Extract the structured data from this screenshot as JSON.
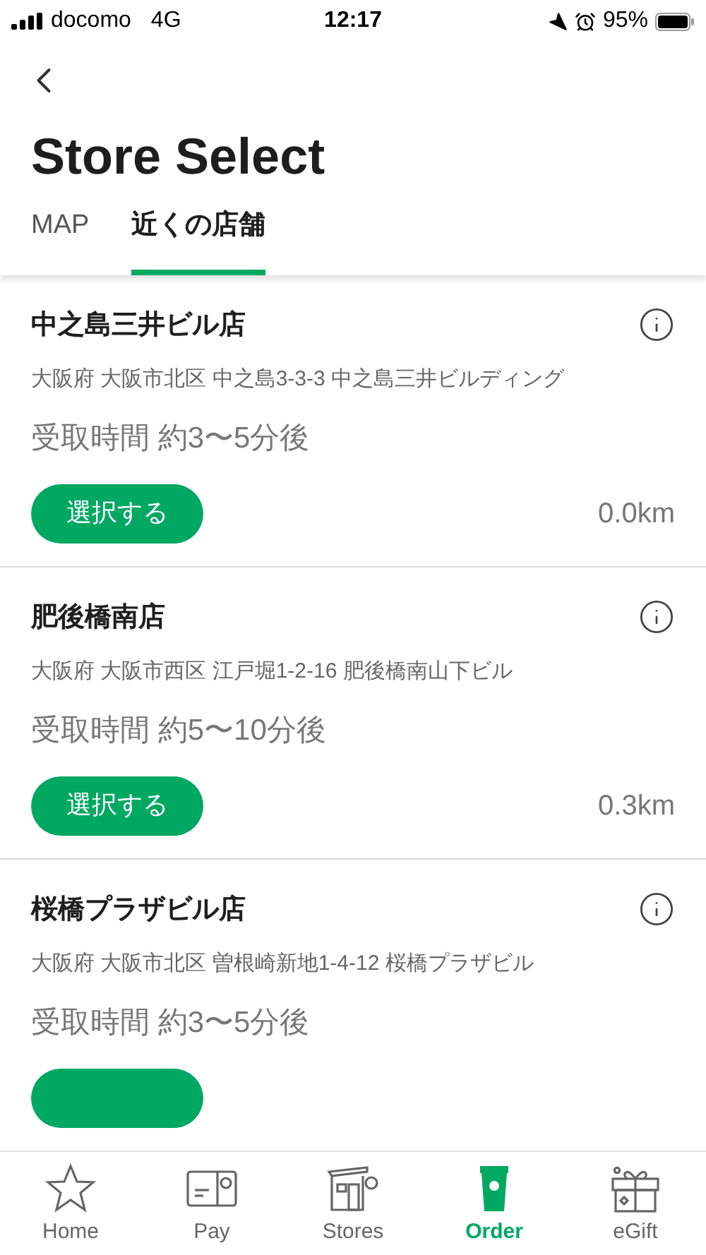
{
  "status_bar": {
    "carrier": "docomo",
    "network": "4G",
    "time": "12:17",
    "battery": "95%"
  },
  "title": "Store Select",
  "tabs": [
    {
      "label": "MAP",
      "selected": false
    },
    {
      "label": "近くの店舗",
      "selected": true
    }
  ],
  "stores": [
    {
      "name": "中之島三井ビル店",
      "address": "大阪府 大阪市北区 中之島3-3-3 中之島三井ビルディング",
      "pickup": "受取時間 約3〜5分後",
      "select_label": "選択する",
      "distance": "0.0km"
    },
    {
      "name": "肥後橋南店",
      "address": "大阪府 大阪市西区 江戸堀1-2-16 肥後橋南山下ビル",
      "pickup": "受取時間 約5〜10分後",
      "select_label": "選択する",
      "distance": "0.3km"
    },
    {
      "name": "桜橋プラザビル店",
      "address": "大阪府 大阪市北区 曽根崎新地1-4-12 桜橋プラザビル",
      "pickup": "受取時間 約3〜5分後"
    }
  ],
  "nav": [
    {
      "label": "Home",
      "kind": "star",
      "selected": false
    },
    {
      "label": "Pay",
      "kind": "card",
      "selected": false
    },
    {
      "label": "Stores",
      "kind": "store",
      "selected": false
    },
    {
      "label": "Order",
      "kind": "cup",
      "selected": true
    },
    {
      "label": "eGift",
      "kind": "gift",
      "selected": false
    }
  ]
}
